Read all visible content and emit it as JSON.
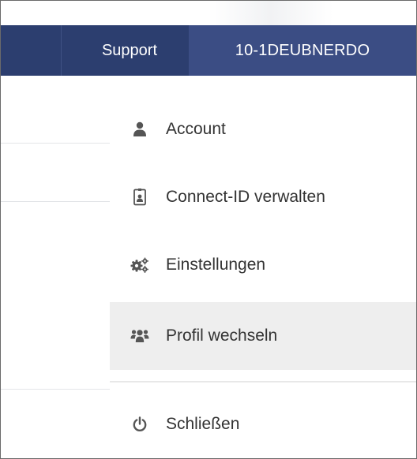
{
  "navbar": {
    "support_label": "Support",
    "user_label": "10-1DEUBNERDO",
    "background_color": "#2c3e6f",
    "user_background_color": "#3b4d84"
  },
  "menu": {
    "items": [
      {
        "label": "Account",
        "icon": "user-icon"
      },
      {
        "label": "Connect-ID verwalten",
        "icon": "id-card-icon"
      },
      {
        "label": "Einstellungen",
        "icon": "cogs-icon"
      },
      {
        "label": "Profil wechseln",
        "icon": "users-icon",
        "active": true
      },
      {
        "label": "Schließen",
        "icon": "power-icon"
      }
    ],
    "icon_color": "#555555",
    "active_background": "#eeeeee"
  }
}
